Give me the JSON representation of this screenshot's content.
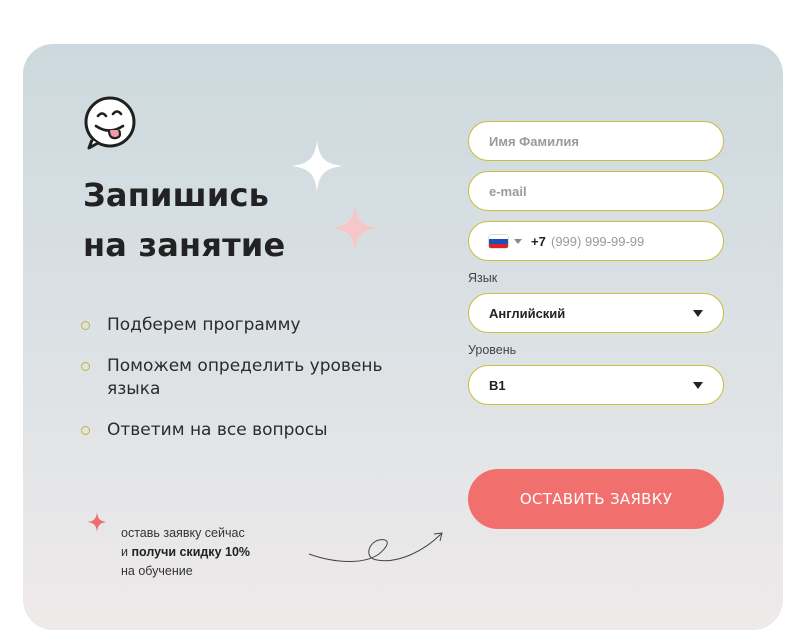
{
  "logo": {
    "icon": "tongue-face-icon"
  },
  "heading": {
    "line1": "Запишись",
    "line2": "на занятие"
  },
  "benefits": [
    "Подберем программу",
    "Поможем определить уровень языка",
    "Ответим на все вопросы"
  ],
  "promo": {
    "line1": "оставь заявку сейчас",
    "line2_prefix": "и ",
    "line2_bold": "получи скидку 10%",
    "line3": "на обучение"
  },
  "form": {
    "name_placeholder": "Имя Фамилия",
    "email_placeholder": "e-mail",
    "phone": {
      "country_code": "+7",
      "placeholder": "(999) 999-99-99",
      "country_icon": "russia-flag-icon"
    },
    "language": {
      "label": "Язык",
      "value": "Английский"
    },
    "level": {
      "label": "Уровень",
      "value": "B1"
    },
    "submit_label": "ОСТАВИТЬ ЗАЯВКУ"
  },
  "colors": {
    "accent": "#f16f6d",
    "field_border": "#c9be3e",
    "sparkle_pink": "#f6c7c9",
    "star_red": "#ef6b6f"
  }
}
